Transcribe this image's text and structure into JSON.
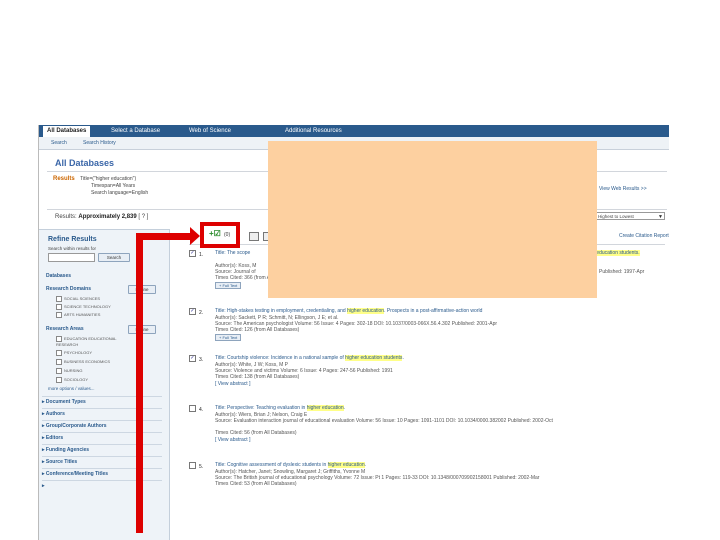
{
  "tabs": [
    "All Databases",
    "Select a Database",
    "Web of Science",
    "Additional Resources"
  ],
  "subnav": [
    "Search",
    "Search History"
  ],
  "page_title": "All Databases",
  "results": {
    "label": "Results",
    "query": "Title=(\"higher education\")",
    "timespan": "Timespan=All Years",
    "language": "Search language=English"
  },
  "approx": {
    "prefix": "Results:",
    "text": "Approximately 2,839",
    "suffix": "[ ? ]"
  },
  "view_web": "View Web Results >>",
  "sort": {
    "value": "Highest to Lowest"
  },
  "sidebar": {
    "title": "Refine Results",
    "search_label": "Search within results for",
    "search_button": "Search",
    "databases": "Databases",
    "research_domains": "Research Domains",
    "refine_button": "Refine",
    "domain_items": [
      "SOCIAL SCIENCES",
      "SCIENCE TECHNOLOGY",
      "ARTS HUMANITIES"
    ],
    "research_areas": "Research Areas",
    "area_items": [
      "EDUCATION EDUCATIONAL RESEARCH",
      "PSYCHOLOGY",
      "BUSINESS ECONOMICS",
      "NURSING",
      "SOCIOLOGY"
    ],
    "more_options": "more options / values...",
    "categories": [
      "Document Types",
      "Authors",
      "Group/Corporate Authors",
      "Editors",
      "Funding Agencies",
      "Source Titles",
      "Conference/Meeting Titles"
    ]
  },
  "toolbar": {
    "mark_count": "(0)",
    "create_citation": "Create Citation Report"
  },
  "records": [
    {
      "num": "1.",
      "title_pre": "Title: The scope",
      "title_hl": "",
      "title_post": "",
      "tail": "higher education students.",
      "authors": "Author(s): Koss, M",
      "source": "Source: Journal of",
      "published": "Published: 1997-Apr",
      "cited": "Times Cited: 366 (from All Databases)",
      "full_text": "Full Text",
      "abstract": "",
      "checked": true
    },
    {
      "num": "2.",
      "title_pre": "Title: High-stakes testing in employment, credentialing, and",
      "title_hl": "higher education",
      "title_post": ". Prospects in a post-affirmative-action world",
      "authors": "Author(s): Sackett, P R; Schmitt, N; Ellingson, J E; et al.",
      "source": "Source: The American psychologist  Volume: 56  Issue: 4  Pages: 302-18  DOI: 10.1037/0003-066X.56.4.302  Published: 2001-Apr",
      "cited": "Times Cited: 126 (from All Databases)",
      "full_text": "Full Text",
      "abstract": "",
      "checked": true
    },
    {
      "num": "3.",
      "title_pre": "Title: Courtship violence: Incidence in a national sample of",
      "title_hl": "higher education students",
      "title_post": ".",
      "authors": "Author(s): White, J W; Koss, M P",
      "source": "Source: Violence and victims  Volume: 6  Issue: 4  Pages: 247-56  Published: 1991",
      "cited": "Times Cited: 138 (from All Databases)",
      "full_text": "",
      "abstract": "[ View abstract ]",
      "checked": true
    },
    {
      "num": "4.",
      "title_pre": "Title: Perspective: Teaching evaluation in",
      "title_hl": "higher education",
      "title_post": ".",
      "authors": "Author(s): Wiers, Brian J; Nelson, Craig E",
      "source": "Source: Evaluation interaction journal of educational evaluation  Volume: 56  Issue: 10  Pages: 1091-1101  DOI: 10.1034/0000.382002  Published: 2002-Oct",
      "cited": "Times Cited: 56 (from All Databases)",
      "full_text": "",
      "abstract": "[ View abstract ]",
      "checked": false
    },
    {
      "num": "5.",
      "title_pre": "Title: Cognitive assessment of dyslexic students in",
      "title_hl": "higher education",
      "title_post": ".",
      "authors": "Author(s): Hatcher, Janet; Snowling, Margaret J; Griffiths, Yvonne M",
      "source": "Source: The British journal of educational psychology  Volume: 72  Issue: Pt 1  Pages: 119-33  DOI: 10.1348/000709902158001  Published: 2002-Mar",
      "cited": "Times Cited: 53 (from All Databases)",
      "full_text": "",
      "abstract": "",
      "checked": false
    }
  ],
  "colors": {
    "overlay": "#fdd0a0",
    "arrow": "#dd0000",
    "highlight": "#ffff88",
    "link": "#2a5a8c"
  }
}
